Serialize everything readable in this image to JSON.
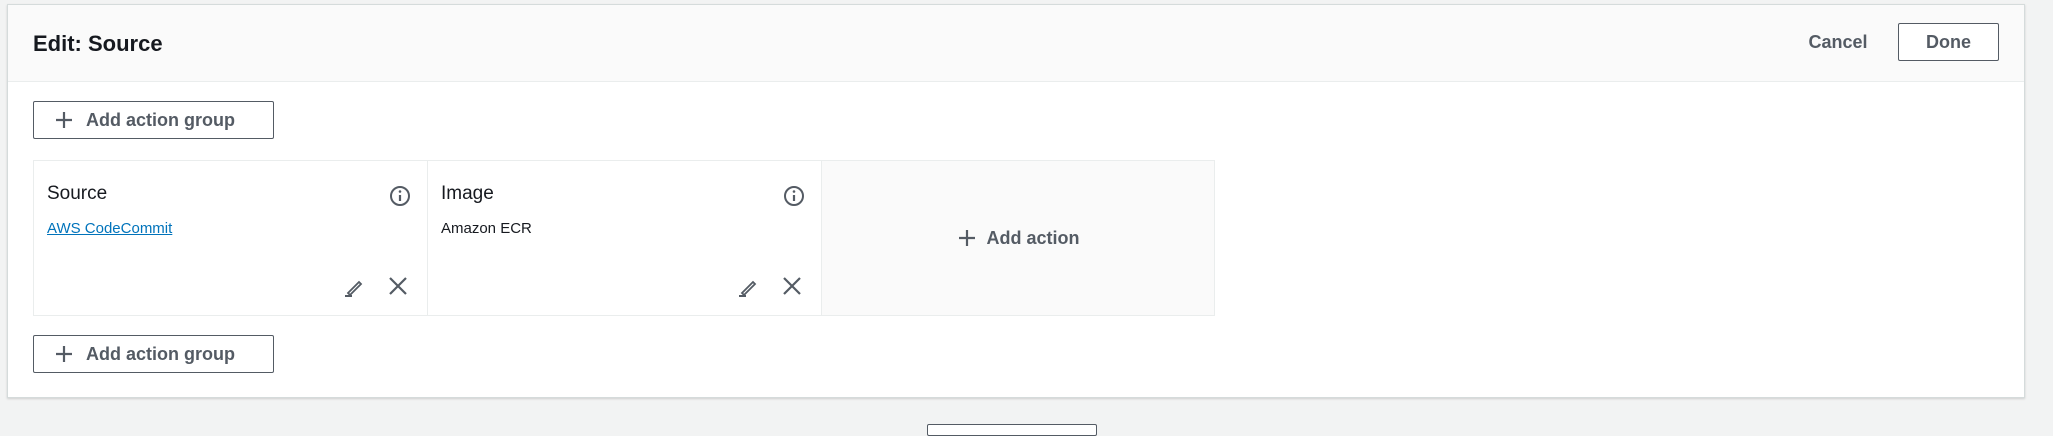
{
  "stage": {
    "title": "Edit: Source",
    "cancel_label": "Cancel",
    "done_label": "Done"
  },
  "add_action_group_label": "Add action group",
  "actions": [
    {
      "name": "Source",
      "provider": "AWS CodeCommit",
      "provider_is_link": true
    },
    {
      "name": "Image",
      "provider": "Amazon ECR",
      "provider_is_link": false
    }
  ],
  "add_action_label": "Add action",
  "icons": {
    "plus": "plus-icon",
    "info": "info-icon",
    "edit": "pencil-icon",
    "remove": "close-icon"
  },
  "colors": {
    "link": "#0073bb",
    "button_text": "#545b64",
    "text": "#16191f",
    "border": "#eaeded",
    "header_bg": "#fafafa",
    "page_bg": "#f2f3f3"
  }
}
